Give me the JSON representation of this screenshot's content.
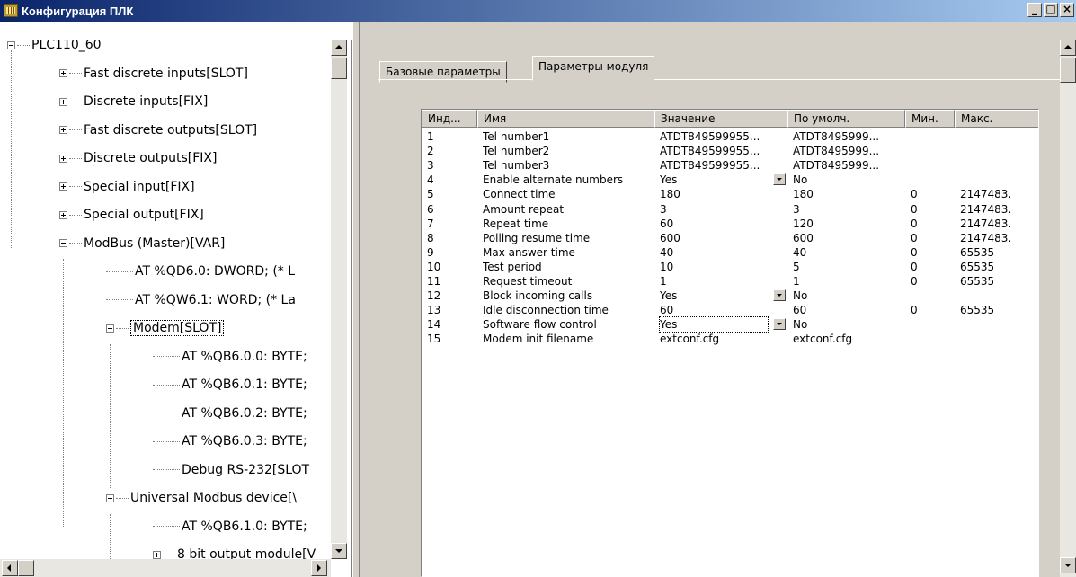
{
  "window": {
    "title": "Конфигурация ПЛК",
    "minimize": "_",
    "maximize": "□",
    "close": "×"
  },
  "tree": {
    "root": "PLC110_60",
    "items": [
      {
        "label": "Fast discrete inputs[SLOT]",
        "expander": "plus"
      },
      {
        "label": "Discrete inputs[FIX]",
        "expander": "plus"
      },
      {
        "label": "Fast discrete outputs[SLOT]",
        "expander": "plus"
      },
      {
        "label": "Discrete outputs[FIX]",
        "expander": "plus"
      },
      {
        "label": "Special input[FIX]",
        "expander": "plus"
      },
      {
        "label": "Special output[FIX]",
        "expander": "plus"
      },
      {
        "label": "ModBus (Master)[VAR]",
        "expander": "minus"
      },
      {
        "label": "AT %QD6.0: DWORD; (* L"
      },
      {
        "label": "AT %QW6.1: WORD; (* La"
      },
      {
        "label": "Modem[SLOT]",
        "expander": "minus",
        "selected": true
      },
      {
        "label": "AT %QB6.0.0: BYTE;"
      },
      {
        "label": "AT %QB6.0.1: BYTE;"
      },
      {
        "label": "AT %QB6.0.2: BYTE;"
      },
      {
        "label": "AT %QB6.0.3: BYTE;"
      },
      {
        "label": "Debug RS-232[SLOT"
      },
      {
        "label": "Universal Modbus device[\\",
        "expander": "minus"
      },
      {
        "label": "AT %QB6.1.0: BYTE;"
      },
      {
        "label": "8 bit output module[V",
        "expander": "plus"
      }
    ]
  },
  "tabs": [
    {
      "label": "Базовые параметры",
      "active": false
    },
    {
      "label": "Параметры модуля",
      "active": true
    }
  ],
  "grid": {
    "columns": [
      "Инд...",
      "Имя",
      "Значение",
      "По умолч.",
      "Мин.",
      "Макс."
    ],
    "rows": [
      {
        "idx": "1",
        "name": "Tel number1",
        "value": "ATDT849599955...",
        "default": "ATDT8495999...",
        "min": "",
        "max": ""
      },
      {
        "idx": "2",
        "name": "Tel number2",
        "value": "ATDT849599955...",
        "default": "ATDT8495999...",
        "min": "",
        "max": ""
      },
      {
        "idx": "3",
        "name": "Tel number3",
        "value": "ATDT849599955...",
        "default": "ATDT8495999...",
        "min": "",
        "max": ""
      },
      {
        "idx": "4",
        "name": "Enable alternate numbers",
        "value": "Yes",
        "default": "No",
        "min": "",
        "max": "",
        "dropdown": true
      },
      {
        "idx": "5",
        "name": "Connect time",
        "value": "180",
        "default": "180",
        "min": "0",
        "max": "2147483."
      },
      {
        "idx": "6",
        "name": "Amount repeat",
        "value": "3",
        "default": "3",
        "min": "0",
        "max": "2147483."
      },
      {
        "idx": "7",
        "name": "Repeat time",
        "value": "60",
        "default": "120",
        "min": "0",
        "max": "2147483."
      },
      {
        "idx": "8",
        "name": "Polling resume time",
        "value": "600",
        "default": "600",
        "min": "0",
        "max": "2147483."
      },
      {
        "idx": "9",
        "name": "Max answer time",
        "value": "40",
        "default": "40",
        "min": "0",
        "max": "65535"
      },
      {
        "idx": "10",
        "name": "Test period",
        "value": "10",
        "default": "5",
        "min": "0",
        "max": "65535"
      },
      {
        "idx": "11",
        "name": "Request timeout",
        "value": "1",
        "default": "1",
        "min": "0",
        "max": "65535"
      },
      {
        "idx": "12",
        "name": "Block incoming calls",
        "value": "Yes",
        "default": "No",
        "min": "",
        "max": "",
        "dropdown": true
      },
      {
        "idx": "13",
        "name": "Idle disconnection time",
        "value": "60",
        "default": "60",
        "min": "0",
        "max": "65535"
      },
      {
        "idx": "14",
        "name": "Software flow control",
        "value": "Yes",
        "default": "No",
        "min": "",
        "max": "",
        "dropdown": true,
        "focused": true
      },
      {
        "idx": "15",
        "name": "Modem init filename",
        "value": "extconf.cfg",
        "default": "extconf.cfg",
        "min": "",
        "max": ""
      }
    ]
  }
}
